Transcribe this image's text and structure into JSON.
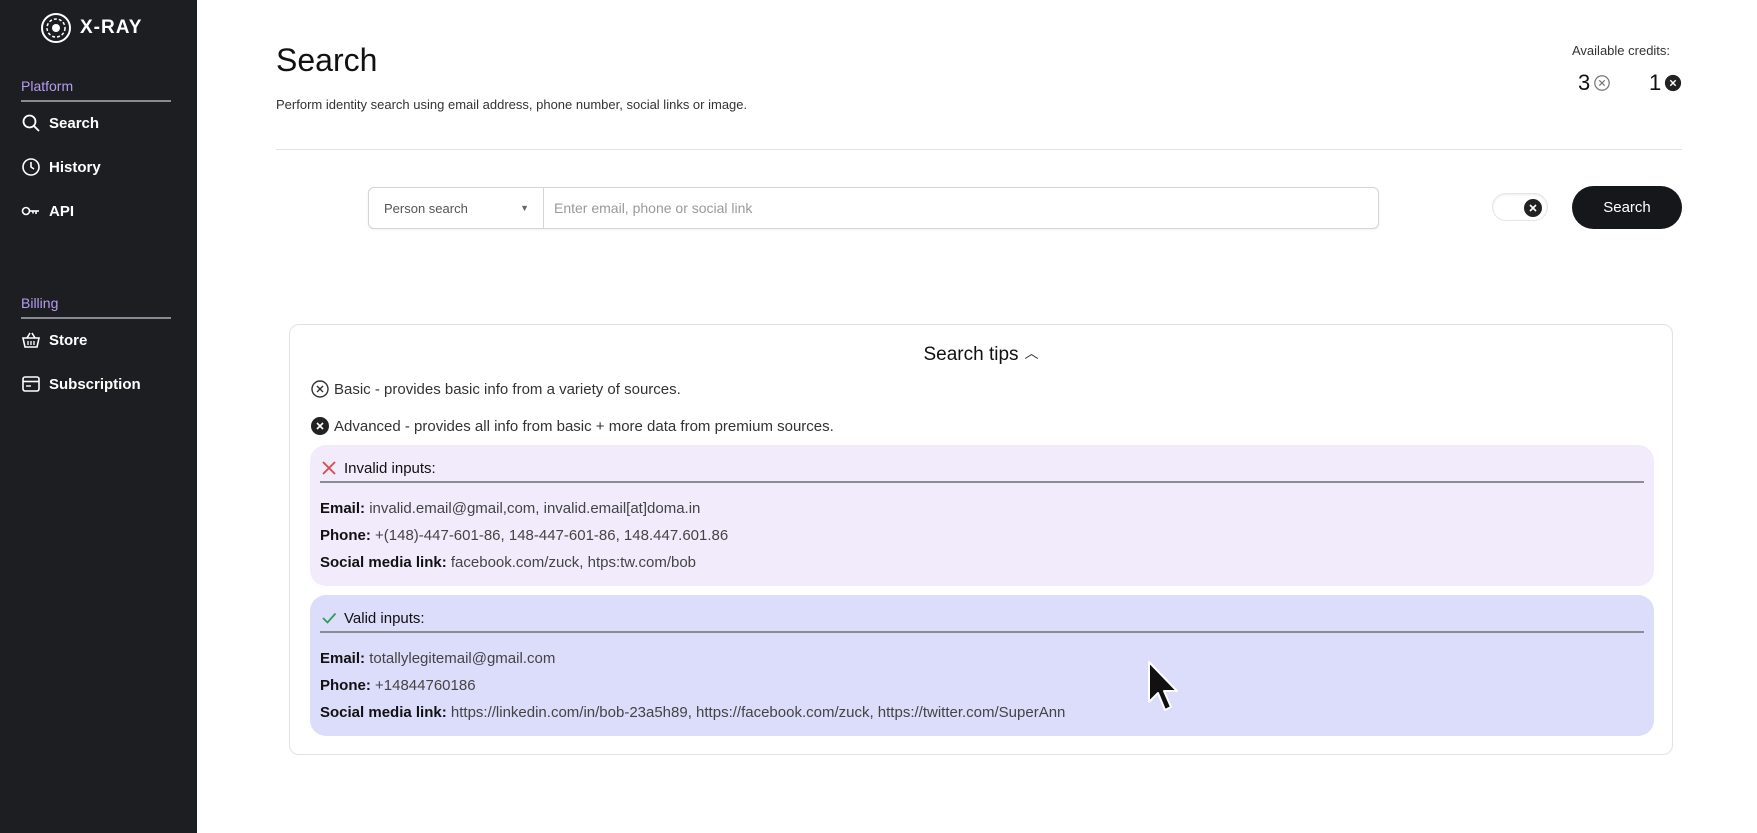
{
  "app": {
    "logo_text": "X-RAY"
  },
  "sidebar": {
    "platform_label": "Platform",
    "billing_label": "Billing",
    "items": [
      {
        "label": "Search",
        "icon": "search-icon"
      },
      {
        "label": "History",
        "icon": "clock-icon"
      },
      {
        "label": "API",
        "icon": "key-icon"
      },
      {
        "label": "Store",
        "icon": "basket-icon"
      },
      {
        "label": "Subscription",
        "icon": "card-icon"
      }
    ]
  },
  "header": {
    "title": "Search",
    "subtitle": "Perform identity search using email address, phone number, social links or image.",
    "credits_label": "Available credits:",
    "credits_basic": "3",
    "credits_advanced": "1"
  },
  "search": {
    "type_selected": "Person search",
    "placeholder": "Enter email, phone or social link",
    "button_label": "Search",
    "advanced_toggle_on": true
  },
  "tips": {
    "title": "Search tips",
    "basic": "Basic - provides basic info from a variety of sources.",
    "advanced": "Advanced - provides all info from basic + more data from premium sources.",
    "invalid": {
      "title": "Invalid inputs:",
      "email_label": "Email:",
      "email": "invalid.email@gmail,com, invalid.email[at]doma.in",
      "phone_label": "Phone:",
      "phone": "+(148)-447-601-86, 148-447-601-86, 148.447.601.86",
      "social_label": "Social media link:",
      "social": "facebook.com/zuck, htps:tw.com/bob"
    },
    "valid": {
      "title": "Valid inputs:",
      "email_label": "Email:",
      "email": "totallylegitemail@gmail.com",
      "phone_label": "Phone:",
      "phone": "+14844760186",
      "social_label": "Social media link:",
      "social": "https://linkedin.com/in/bob-23a5h89, https://facebook.com/zuck, https://twitter.com/SuperAnn"
    }
  },
  "colors": {
    "sidebar_bg": "#1d1e22",
    "section_accent": "#b59cf0",
    "invalid_bg": "#f1ebfb",
    "valid_bg": "#dcdcfb",
    "invalid_icon": "#e04848",
    "valid_icon": "#2e9e55"
  }
}
